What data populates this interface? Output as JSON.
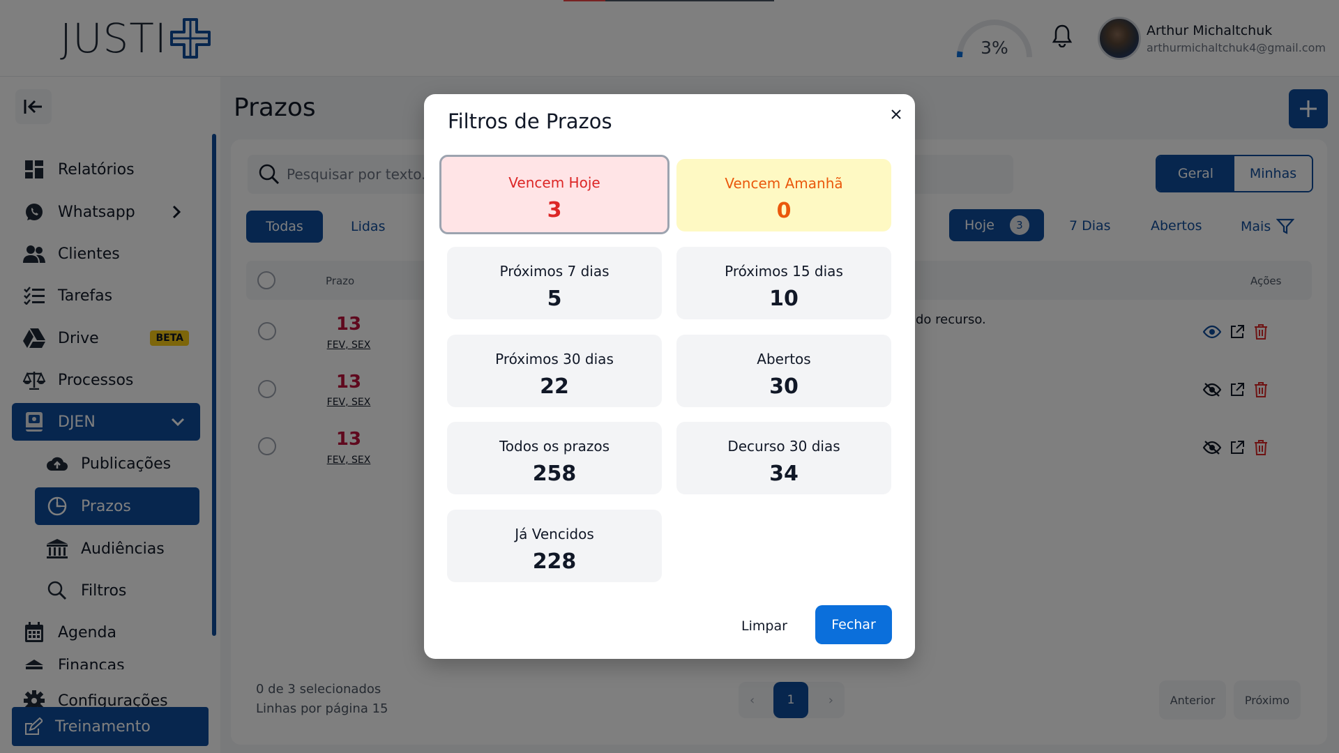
{
  "header": {
    "logo_text": "JUSTI",
    "gauge_percent": "3%",
    "gauge_fraction": 0.03,
    "user_name": "Arthur Michaltchuk",
    "user_email": "arthurmichaltchuk4@gmail.com"
  },
  "sidebar": {
    "items": [
      {
        "label": "Relatórios",
        "icon": "dashboard-icon"
      },
      {
        "label": "Whatsapp",
        "icon": "whatsapp-icon"
      },
      {
        "label": "Clientes",
        "icon": "users-icon"
      },
      {
        "label": "Tarefas",
        "icon": "tasks-list-icon"
      },
      {
        "label": "Drive",
        "icon": "drive-icon",
        "badge": "BETA"
      },
      {
        "label": "Processos",
        "icon": "scales-icon"
      },
      {
        "label": "DJEN",
        "icon": "book-icon"
      },
      {
        "label": "Publicações",
        "icon": "cloud-upload-icon"
      },
      {
        "label": "Prazos",
        "icon": "clock-pie-icon"
      },
      {
        "label": "Audiências",
        "icon": "bank-icon"
      },
      {
        "label": "Filtros",
        "icon": "search-icon"
      },
      {
        "label": "Agenda",
        "icon": "calendar-icon"
      },
      {
        "label": "Financas",
        "icon": "finance-icon"
      },
      {
        "label": "Configurações",
        "icon": "gear-icon"
      }
    ],
    "training_label": "Treinamento"
  },
  "main": {
    "title": "Prazos",
    "search_placeholder": "Pesquisar por texto...",
    "scope_toggle": [
      "Geral",
      "Minhas"
    ],
    "tabs": [
      "Todas",
      "Lidas"
    ],
    "filters": {
      "hoje": "Hoje",
      "hoje_count": "3",
      "sete_dias": "7 Dias",
      "abertos": "Abertos",
      "mais": "Mais"
    },
    "columns": {
      "prazo": "Prazo",
      "acoes": "Ações"
    },
    "rows": [
      {
        "day": "13",
        "weekday": "FEV, SEX",
        "text": "do recurso."
      },
      {
        "day": "13",
        "weekday": "FEV, SEX",
        "text": ""
      },
      {
        "day": "13",
        "weekday": "FEV, SEX",
        "text": ""
      }
    ],
    "footer": {
      "selected": "0 de 3 selecionados",
      "rows_per_page": "Linhas por página 15"
    },
    "pagination": {
      "current": "1",
      "prev": "Anterior",
      "next": "Próximo"
    }
  },
  "modal": {
    "title": "Filtros de Prazos",
    "tiles": [
      {
        "label": "Vencem Hoje",
        "value": "3",
        "style": "red"
      },
      {
        "label": "Vencem Amanhã",
        "value": "0",
        "style": "yellow"
      },
      {
        "label": "Próximos 7 dias",
        "value": "5",
        "style": "default"
      },
      {
        "label": "Próximos 15 dias",
        "value": "10",
        "style": "default"
      },
      {
        "label": "Próximos 30 dias",
        "value": "22",
        "style": "default"
      },
      {
        "label": "Abertos",
        "value": "30",
        "style": "default"
      },
      {
        "label": "Todos os prazos",
        "value": "258",
        "style": "default"
      },
      {
        "label": "Decurso 30 dias",
        "value": "34",
        "style": "default"
      },
      {
        "label": "Já Vencidos",
        "value": "228",
        "style": "default"
      }
    ],
    "clear_label": "Limpar",
    "close_label": "Fechar"
  },
  "colors": {
    "primary": "#0f4c9c",
    "accent_blue": "#0b6fdb",
    "danger": "#dc2626",
    "warning": "#ea580c"
  }
}
